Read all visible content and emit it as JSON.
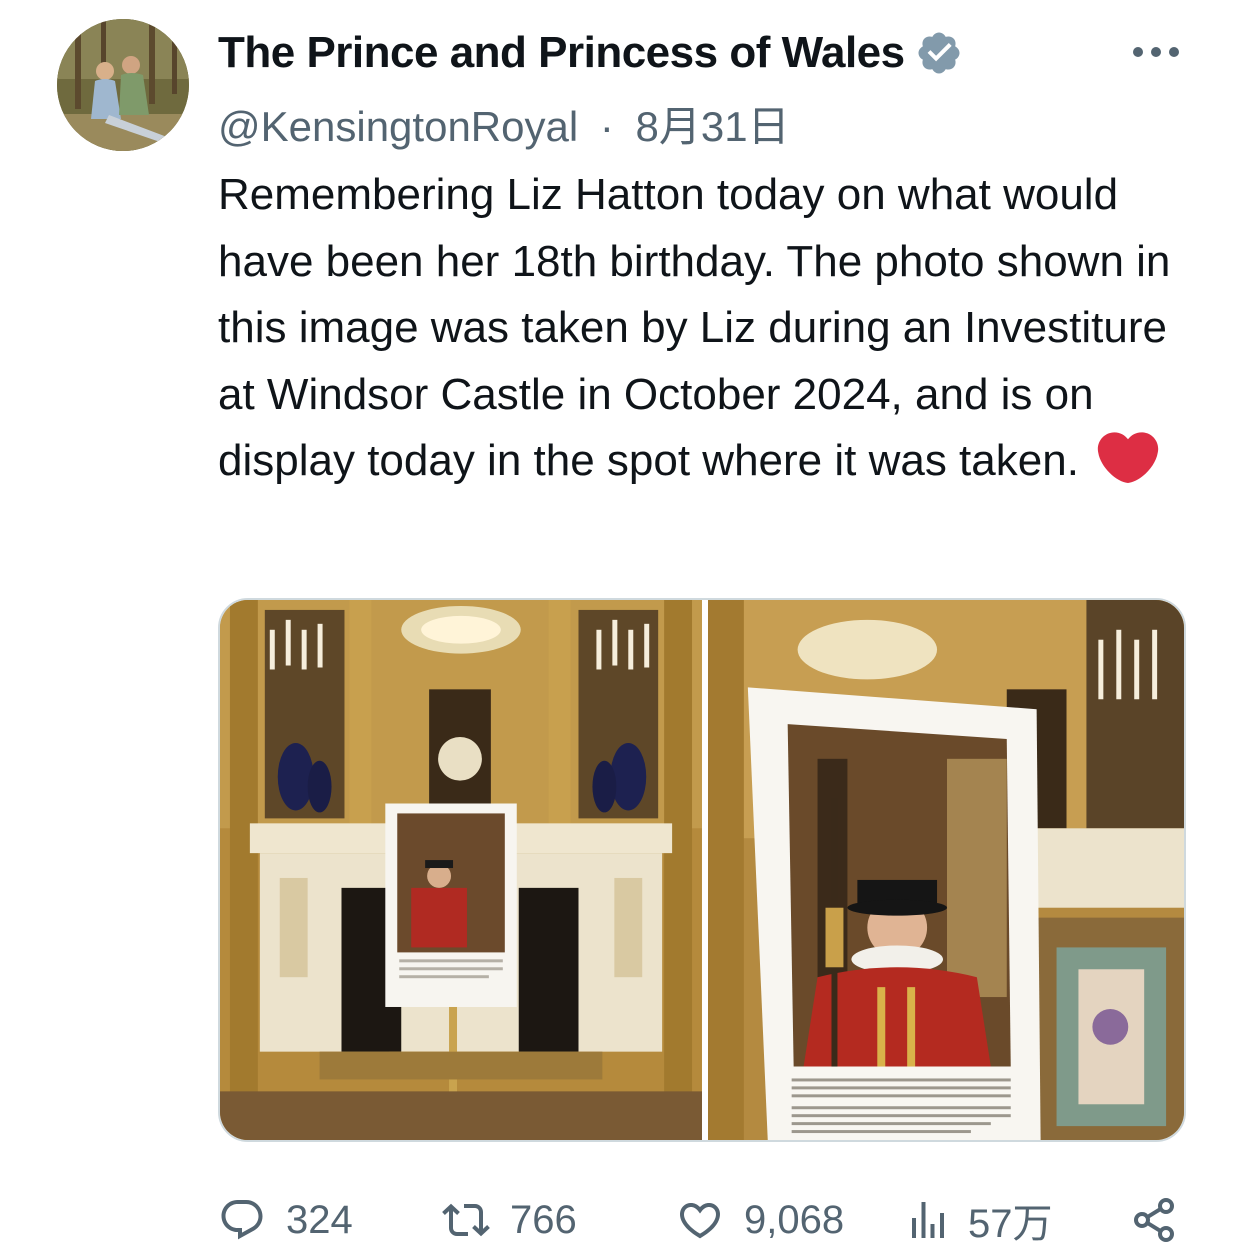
{
  "author": {
    "display_name": "The Prince and Princess of Wales",
    "handle": "@KensingtonRoyal",
    "separator": "·",
    "date": "8月31日",
    "verified": true,
    "avatar_icon": "profile-photo"
  },
  "tweet": {
    "text": "Remembering Liz Hatton today on what would have been her 18th birthday. The photo shown in this image was taken by Liz during an Investiture at Windsor Castle in October 2024, and is on display today in the spot where it was taken.",
    "emoji": "red-heart"
  },
  "media": {
    "images": [
      {
        "name": "photo-fireplace-room"
      },
      {
        "name": "photo-yeoman-portrait"
      }
    ]
  },
  "stats": {
    "replies": "324",
    "reposts": "766",
    "likes": "9,068",
    "views": "57万"
  },
  "icons": {
    "more": "more-horizontal-icon",
    "reply": "reply-icon",
    "repost": "repost-icon",
    "like": "heart-icon",
    "views": "views-icon",
    "share": "share-icon"
  },
  "colors": {
    "text": "#0f1419",
    "secondary": "#536471",
    "verified_badge": "#829aab",
    "heart_emoji": "#dd2e44",
    "border": "#cfd9de"
  }
}
